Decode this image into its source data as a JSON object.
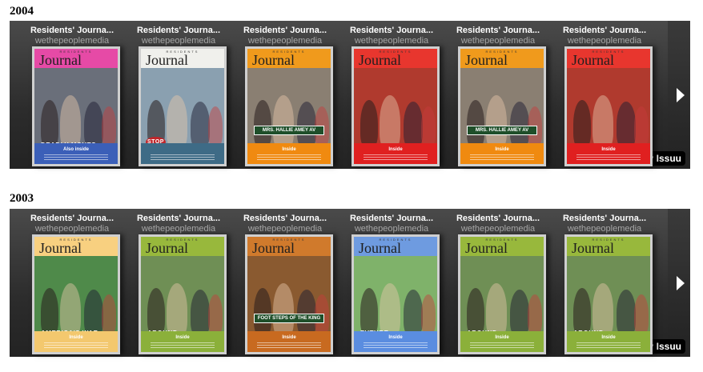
{
  "sections": [
    {
      "year": "2004",
      "badge": "Shelf by Issuu",
      "issues": [
        {
          "title": "Residents' Journa...",
          "author": "wethepeoplemedia",
          "cover": {
            "masthead": "Journal",
            "kicker": "RESIDENTS",
            "band_color": "#e64aa6",
            "footer_color": "#3b5fb8",
            "footer_label": "Also inside",
            "headline": "DEADLY MOVES",
            "photo_bg": "#6a6f7a"
          }
        },
        {
          "title": "Residents' Journa...",
          "author": "wethepeoplemedia",
          "cover": {
            "masthead": "Journal",
            "kicker": "RESIDENTS",
            "band_color": "#f0f0ec",
            "footer_color": "#3e6b86",
            "footer_label": "",
            "headline": "STOP",
            "photo_bg": "#8aa0b0"
          }
        },
        {
          "title": "Residents' Journa...",
          "author": "wethepeoplemedia",
          "cover": {
            "masthead": "Journal",
            "kicker": "RESIDENTS",
            "band_color": "#f09a1c",
            "footer_color": "#f08a10",
            "footer_label": "Inside",
            "headline": "MRS. HALLIE AMEY AV",
            "photo_bg": "#8a7f72"
          }
        },
        {
          "title": "Residents' Journa...",
          "author": "wethepeoplemedia",
          "cover": {
            "masthead": "Journal",
            "kicker": "RESIDENTS",
            "band_color": "#e8362e",
            "footer_color": "#e02020",
            "footer_label": "Inside",
            "headline": "",
            "photo_bg": "#b03a2e"
          }
        },
        {
          "title": "Residents' Journa...",
          "author": "wethepeoplemedia",
          "cover": {
            "masthead": "Journal",
            "kicker": "RESIDENTS",
            "band_color": "#f09a1c",
            "footer_color": "#f08a10",
            "footer_label": "Inside",
            "headline": "MRS. HALLIE AMEY AV",
            "photo_bg": "#8a7f72"
          }
        },
        {
          "title": "Residents' Journa...",
          "author": "wethepeoplemedia",
          "cover": {
            "masthead": "Journal",
            "kicker": "RESIDENTS",
            "band_color": "#e8362e",
            "footer_color": "#e02020",
            "footer_label": "Inside",
            "headline": "",
            "photo_bg": "#b03a2e"
          }
        }
      ]
    },
    {
      "year": "2003",
      "badge": "Shelf by Issuu",
      "issues": [
        {
          "title": "Residents' Journa...",
          "author": "wethepeoplemedia",
          "cover": {
            "masthead": "Journal",
            "kicker": "RESIDENTS",
            "band_color": "#f8d080",
            "footer_color": "#f3c86e",
            "footer_label": "Inside",
            "headline": "AMERICA'S WAR",
            "photo_bg": "#4f8a4a"
          }
        },
        {
          "title": "Residents' Journa...",
          "author": "wethepeoplemedia",
          "cover": {
            "masthead": "Journal",
            "kicker": "RESIDENTS",
            "band_color": "#98b83c",
            "footer_color": "#8bb03a",
            "footer_label": "Inside",
            "headline": "AROUND",
            "photo_bg": "#6f8f55"
          }
        },
        {
          "title": "Residents' Journa...",
          "author": "wethepeoplemedia",
          "cover": {
            "masthead": "Journal",
            "kicker": "RESIDENTS",
            "band_color": "#d07a2c",
            "footer_color": "#c86a20",
            "footer_label": "Inside",
            "headline": "FOOT STEPS OF THE KING",
            "photo_bg": "#8a5a30"
          }
        },
        {
          "title": "Residents' Journa...",
          "author": "wethepeoplemedia",
          "cover": {
            "masthead": "Journal",
            "kicker": "RESIDENTS",
            "band_color": "#6e9be0",
            "footer_color": "#5a8de0",
            "footer_label": "Inside",
            "headline": "FUTURE",
            "photo_bg": "#7fb26a"
          }
        },
        {
          "title": "Residents' Journa...",
          "author": "wethepeoplemedia",
          "cover": {
            "masthead": "Journal",
            "kicker": "RESIDENTS",
            "band_color": "#98b83c",
            "footer_color": "#8bb03a",
            "footer_label": "Inside",
            "headline": "AROUND",
            "photo_bg": "#6f8f55"
          }
        },
        {
          "title": "Residents' Journa...",
          "author": "wethepeoplemedia",
          "cover": {
            "masthead": "Journal",
            "kicker": "RESIDENTS",
            "band_color": "#98b83c",
            "footer_color": "#8bb03a",
            "footer_label": "Inside",
            "headline": "AROUND",
            "photo_bg": "#6f8f55"
          }
        }
      ]
    }
  ],
  "icons": {
    "next": "chevron-right-icon"
  }
}
